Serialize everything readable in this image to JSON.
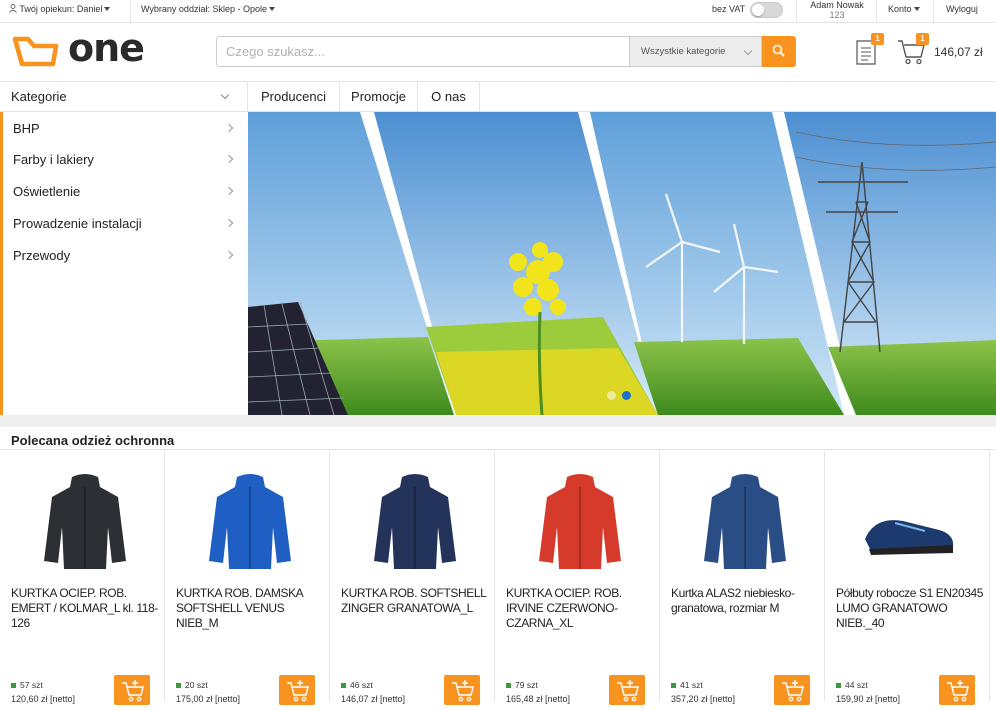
{
  "topbar": {
    "caretaker_label": "Twój opiekun: Daniel",
    "branch_label": "Wybrany oddział: Sklep - Opole",
    "vat_label": "bez VAT",
    "user_name": "Adam Nowak",
    "user_id": "123",
    "account_label": "Konto",
    "logout_label": "Wyloguj"
  },
  "header": {
    "logo_text": "one",
    "search_placeholder": "Czego szukasz...",
    "search_category": "Wszystkie kategorie",
    "docs_badge": "1",
    "cart_badge": "1",
    "cart_total": "146,07 zł",
    "accent_color": "#f7931e"
  },
  "nav": {
    "categories_label": "Kategorie",
    "links": [
      "Producenci",
      "Promocje",
      "O nas"
    ]
  },
  "sidebar": {
    "items": [
      "BHP",
      "Farby i lakiery",
      "Oświetlenie",
      "Prowadzenie instalacji",
      "Przewody"
    ]
  },
  "banner": {
    "slides": 2,
    "active_slide": 2
  },
  "featured": {
    "title": "Polecana odzież ochronna",
    "products": [
      {
        "name": "KURTKA OCIEP. ROB. EMERT / KOLMAR_L kl. 118-126",
        "stock": "57 szt",
        "price": "120,60 zł [netto]",
        "color": "#2c2f33"
      },
      {
        "name": "KURTKA ROB. DAMSKA SOFTSHELL VENUS NIEB_M",
        "stock": "20 szt",
        "price": "175,00 zł [netto]",
        "color": "#1f5fc4"
      },
      {
        "name": "KURTKA ROB. SOFTSHELL ZINGER GRANATOWA_L",
        "stock": "46 szt",
        "price": "146,07 zł [netto]",
        "color": "#23335a"
      },
      {
        "name": "KURTKA OCIEP. ROB. IRVINE CZERWONO-CZARNA_XL",
        "stock": "79 szt",
        "price": "165,48 zł [netto]",
        "color": "#d63a2a"
      },
      {
        "name": "Kurtka ALAS2 niebiesko-granatowa, rozmiar M",
        "stock": "41 szt",
        "price": "357,20 zł [netto]",
        "color": "#2a4d86"
      },
      {
        "name": "Półbuty robocze S1 EN20345 LUMO GRANATOWO NIEB._40",
        "stock": "44 szt",
        "price": "159,90 zł [netto]",
        "color": "#1c3a6e"
      }
    ]
  }
}
